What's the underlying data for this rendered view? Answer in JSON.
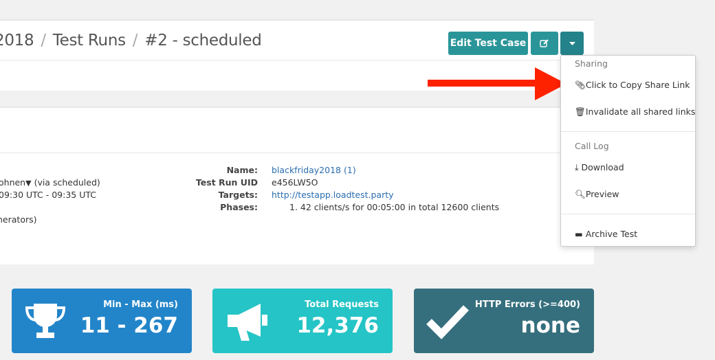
{
  "breadcrumb": [
    "2018",
    "Test Runs",
    "#2 - scheduled"
  ],
  "toolbar": {
    "edit_label": "Edit Test Case",
    "edit_icon": "pencil-square-icon",
    "caret_icon": "caret-down-icon"
  },
  "run": {
    "user": "ohnen",
    "user_suffix": "(via scheduled)",
    "time": "09:30 UTC - 09:35 UTC",
    "generators": "nerators)"
  },
  "details": {
    "name_label": "Name:",
    "name": "blackfriday2018",
    "name_count": "(1)",
    "uid_label": "Test Run UID",
    "uid": "e456LW5O",
    "targets_label": "Targets:",
    "target": "http://testapp.loadtest.party",
    "phases_label": "Phases:",
    "phase": "1. 42 clients/s for 00:05:00 in total 12600 clients"
  },
  "menu": {
    "sharing": "Sharing",
    "copy": "Click to Copy Share Link",
    "invalidate": "Invalidate all shared links",
    "call_log": "Call Log",
    "download": "Download",
    "preview": "Preview",
    "archive": "Archive Test"
  },
  "cards": [
    {
      "label": "Min - Max (ms)",
      "value": "11 - 267",
      "color": "#2385c9",
      "icon": "trophy-icon"
    },
    {
      "label": "Total Requests",
      "value": "12,376",
      "color": "#25c4c6",
      "icon": "bullhorn-icon"
    },
    {
      "label": "HTTP Errors (>=400)",
      "value": "none",
      "color": "#356f7d",
      "icon": "check-icon"
    }
  ],
  "annotation": {
    "arrow_color": "#ff2200"
  }
}
